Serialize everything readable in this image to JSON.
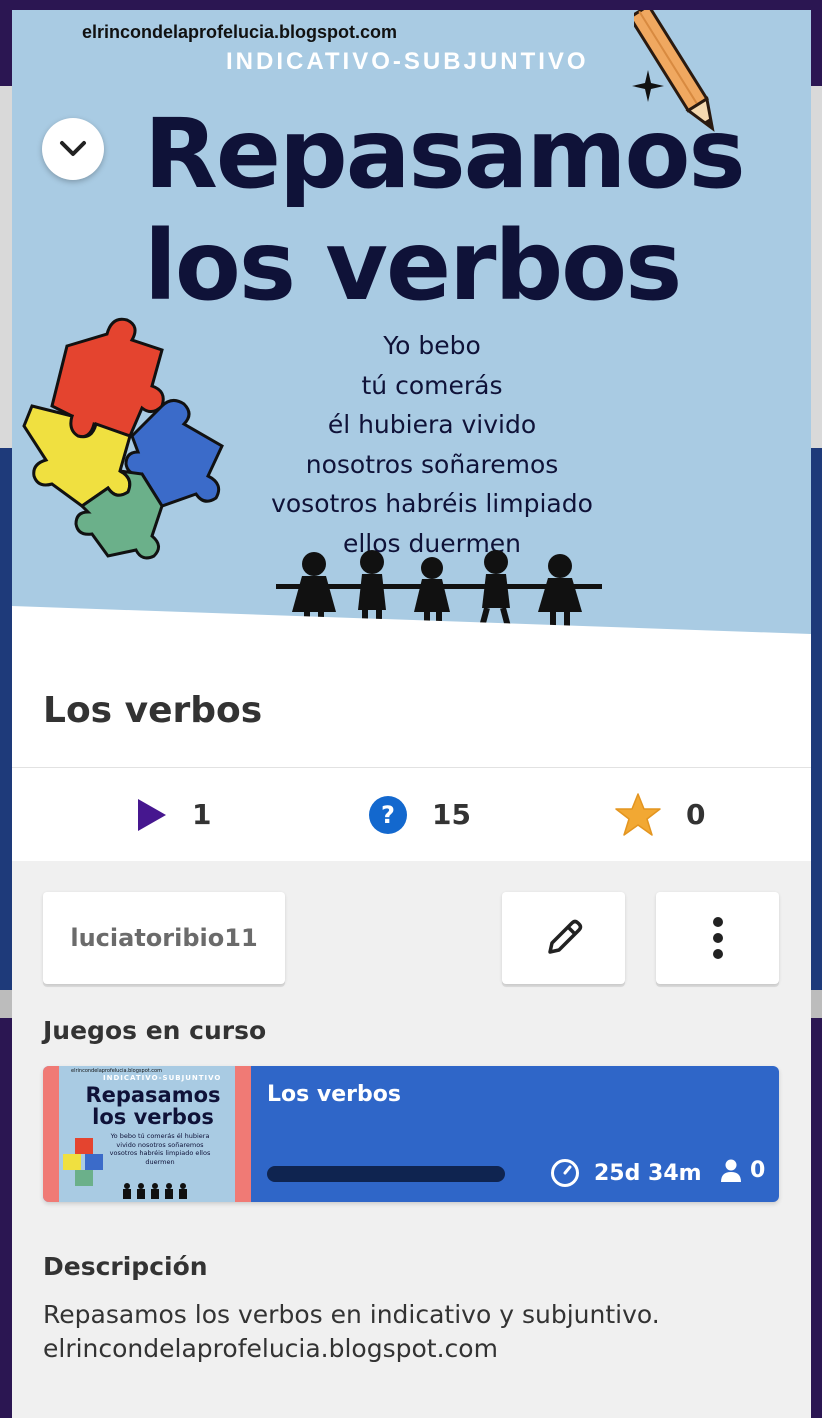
{
  "cover": {
    "site": "elrincondelaprofelucia.blogspot.com",
    "subtitle": "INDICATIVO-SUBJUNTIVO",
    "headline_1": "Repasamos",
    "headline_2": "los verbos",
    "verses": [
      "Yo bebo",
      "tú comerás",
      "él hubiera vivido",
      "nosotros soñaremos",
      "vosotros habréis limpiado",
      "ellos duermen"
    ]
  },
  "quiz": {
    "title": "Los verbos"
  },
  "stats": {
    "plays": "1",
    "questions": "15",
    "favorites": "0"
  },
  "author": "luciatoribio11",
  "sections": {
    "games_in_progress": "Juegos en curso",
    "description": "Descripción"
  },
  "game": {
    "title": "Los verbos",
    "time_left": "25d 34m",
    "players": "0",
    "progress": 0.0,
    "thumb_site": "elrincondelaprofelucia.blogspot.com",
    "thumb_subtitle": "INDICATIVO-SUBJUNTIVO",
    "thumb_headline": "Repasamos los verbos",
    "thumb_verses": "Yo bebo tú comerás él hubiera vivido nosotros soñaremos vosotros habréis limpiado ellos duermen"
  },
  "description_text_1": "Repasamos los verbos en indicativo y subjuntivo.",
  "description_text_2": "elrincondelaprofelucia.blogspot.com",
  "colors": {
    "cover_bg": "#a9cbe3",
    "navy": "#0f1238",
    "game_blue": "#2f66c8",
    "play_purple": "#46178f",
    "question_blue": "#1368ce",
    "star_gold": "#f2a833"
  },
  "icons": [
    "chevron-down-icon",
    "play-icon",
    "question-icon",
    "star-icon",
    "pencil-icon",
    "more-vertical-icon",
    "timer-icon",
    "person-icon"
  ]
}
